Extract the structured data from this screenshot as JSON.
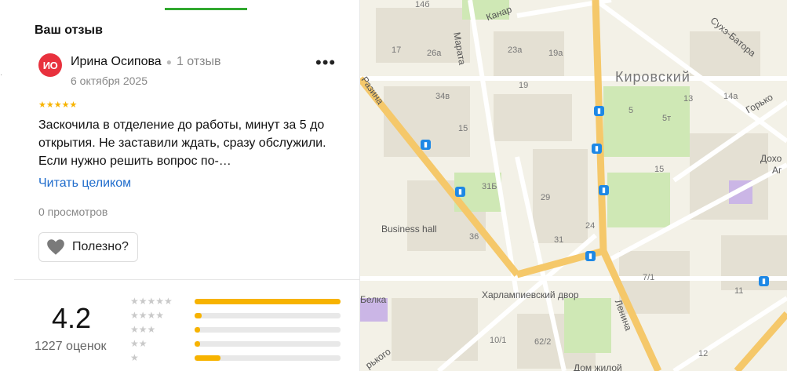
{
  "review_section": {
    "title": "Ваш отзыв",
    "author_initials": "ИО",
    "author_name": "Ирина Осипова",
    "author_reviews": "1 отзыв",
    "date": "6 октября 2025",
    "more_glyph": "•••",
    "stars_glyph": "★★★★★",
    "text": "Заскочила в отделение до работы, минут за 5 до открытия. Не заставили ждать, сразу обслужили. Если нужно решить вопрос по-…",
    "read_more": "Читать целиком",
    "views": "0 просмотров",
    "useful_label": "Полезно?"
  },
  "rating_summary": {
    "score": "4.2",
    "count": "1227 оценок",
    "distribution": [
      {
        "stars": "★★★★★",
        "fill": 1.0
      },
      {
        "stars": "★★★★",
        "fill": 0.05
      },
      {
        "stars": "★★★",
        "fill": 0.04
      },
      {
        "stars": "★★",
        "fill": 0.04
      },
      {
        "stars": "★",
        "fill": 0.18
      }
    ]
  },
  "map": {
    "labels": {
      "district": "Кировский",
      "street_marata": "Марата",
      "street_kanal": "Канар",
      "street_razina": "Разина",
      "street_sukhe": "Сухэ-Батора",
      "street_gorky": "Горько",
      "street_lenina": "Ленина",
      "street_gorkogo_bottom": "рького",
      "poi_business_hall": "Business hall",
      "poi_kharlampievsky": "Харлампиевский двор",
      "poi_belka": "Белка",
      "poi_dohod": "Дохо",
      "poi_ag": "Аг",
      "poi_dom": "Дом жилой"
    },
    "numbers": [
      "14б",
      "26а",
      "23а",
      "19а",
      "17",
      "19",
      "34в",
      "15",
      "5",
      "5т",
      "14а",
      "31Б",
      "29",
      "15",
      "13",
      "36",
      "24",
      "31",
      "7/1",
      "11",
      "10/1",
      "62/2",
      "12"
    ],
    "colors": {
      "background": "#f3f1e7",
      "park": "#cfe8b5",
      "major_road": "#f5c86a",
      "road": "#ffffff",
      "building": "#e4e0d3",
      "bus": "#1e88e5"
    }
  }
}
